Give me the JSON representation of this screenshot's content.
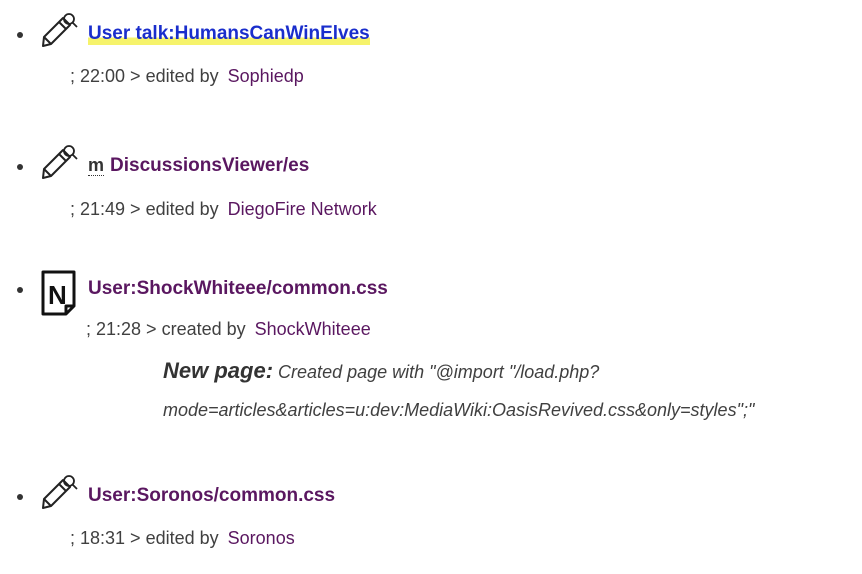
{
  "entries": [
    {
      "title": "User talk:HumansCanWinElves",
      "minor": "",
      "time": "; 22:00 >",
      "action": "edited by",
      "user": "Sophiedp",
      "icon": "edit-icon"
    },
    {
      "title": "DiscussionsViewer/es",
      "minor": "m",
      "time": "; 21:49 >",
      "action": "edited by",
      "user": "DiegoFire Network",
      "icon": "edit-icon"
    },
    {
      "title": "User:ShockWhiteee/common.css",
      "minor": "",
      "time": "; 21:28 >",
      "action": "created by",
      "user": "ShockWhiteee",
      "icon": "new-page-icon",
      "summary_label": "New page:",
      "summary_line1": "Created page with \"@import \"/load.php?",
      "summary_line2": "mode=articles&articles=u:dev:MediaWiki:OasisRevived.css&only=styles\";\""
    },
    {
      "title": "User:Soronos/common.css",
      "minor": "",
      "time": "; 18:31 >",
      "action": "edited by",
      "user": "Soronos",
      "icon": "edit-icon"
    }
  ],
  "colors": {
    "new_link": "#1a2ecc",
    "visited_link": "#5a1760",
    "highlight": "#f6f36b"
  }
}
